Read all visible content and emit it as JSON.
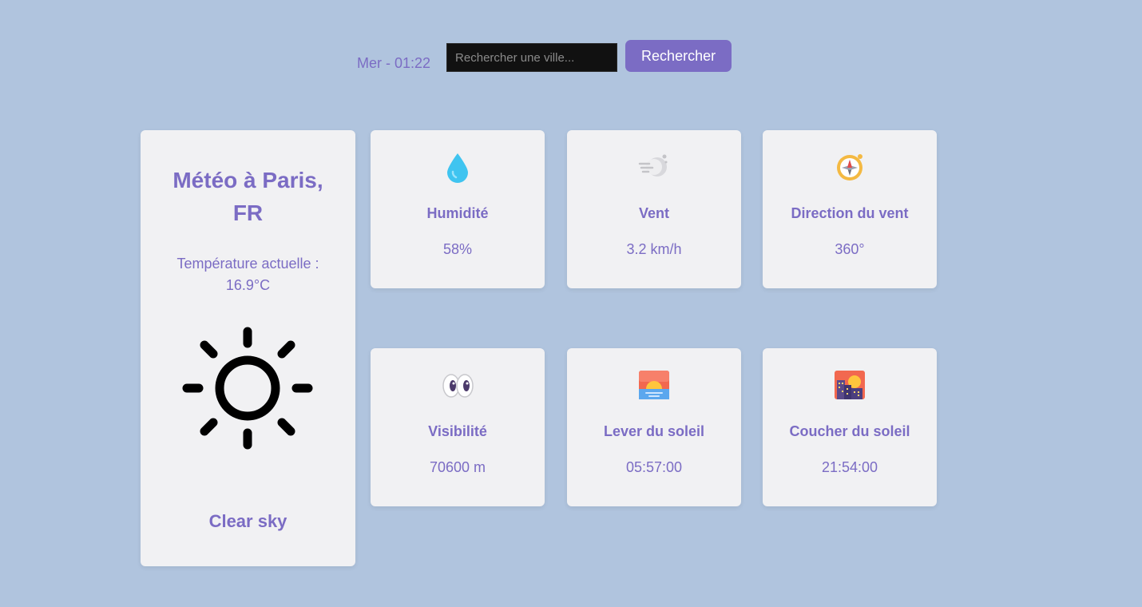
{
  "header": {
    "datetime": "Mer - 01:22",
    "search_placeholder": "Rechercher une ville...",
    "search_value": "",
    "search_button_label": "Rechercher"
  },
  "main": {
    "title": "Météo à Paris, FR",
    "temperature_line1": "Température actuelle :",
    "temperature_line2": "16.9°C",
    "icon": "sun-icon",
    "condition": "Clear sky"
  },
  "stats": [
    {
      "icon": "droplet-icon",
      "label": "Humidité",
      "value": "58%"
    },
    {
      "icon": "wind-icon",
      "label": "Vent",
      "value": "3.2 km/h"
    },
    {
      "icon": "compass-icon",
      "label": "Direction du vent",
      "value": "360°"
    },
    {
      "icon": "eyes-icon",
      "label": "Visibilité",
      "value": "70600 m"
    },
    {
      "icon": "sunrise-icon",
      "label": "Lever du soleil",
      "value": "05:57:00"
    },
    {
      "icon": "sunset-city-icon",
      "label": "Coucher du soleil",
      "value": "21:54:00"
    }
  ],
  "colors": {
    "background": "#b0c4de",
    "accent": "#7b6cc4",
    "card": "#f1f1f3",
    "input_bg": "#111111"
  }
}
